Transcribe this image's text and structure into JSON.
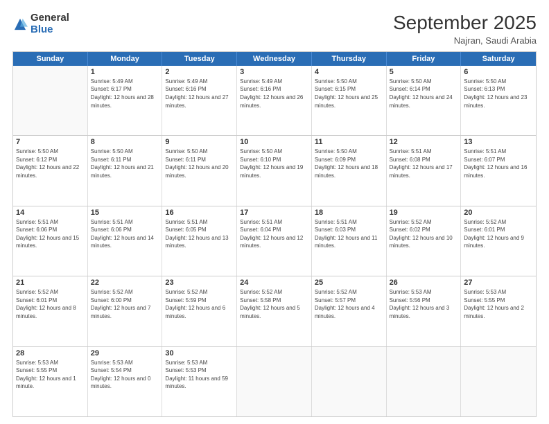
{
  "logo": {
    "general": "General",
    "blue": "Blue"
  },
  "header": {
    "month": "September 2025",
    "location": "Najran, Saudi Arabia"
  },
  "weekdays": [
    "Sunday",
    "Monday",
    "Tuesday",
    "Wednesday",
    "Thursday",
    "Friday",
    "Saturday"
  ],
  "weeks": [
    [
      {
        "day": "",
        "sunrise": "",
        "sunset": "",
        "daylight": ""
      },
      {
        "day": "1",
        "sunrise": "Sunrise: 5:49 AM",
        "sunset": "Sunset: 6:17 PM",
        "daylight": "Daylight: 12 hours and 28 minutes."
      },
      {
        "day": "2",
        "sunrise": "Sunrise: 5:49 AM",
        "sunset": "Sunset: 6:16 PM",
        "daylight": "Daylight: 12 hours and 27 minutes."
      },
      {
        "day": "3",
        "sunrise": "Sunrise: 5:49 AM",
        "sunset": "Sunset: 6:16 PM",
        "daylight": "Daylight: 12 hours and 26 minutes."
      },
      {
        "day": "4",
        "sunrise": "Sunrise: 5:50 AM",
        "sunset": "Sunset: 6:15 PM",
        "daylight": "Daylight: 12 hours and 25 minutes."
      },
      {
        "day": "5",
        "sunrise": "Sunrise: 5:50 AM",
        "sunset": "Sunset: 6:14 PM",
        "daylight": "Daylight: 12 hours and 24 minutes."
      },
      {
        "day": "6",
        "sunrise": "Sunrise: 5:50 AM",
        "sunset": "Sunset: 6:13 PM",
        "daylight": "Daylight: 12 hours and 23 minutes."
      }
    ],
    [
      {
        "day": "7",
        "sunrise": "Sunrise: 5:50 AM",
        "sunset": "Sunset: 6:12 PM",
        "daylight": "Daylight: 12 hours and 22 minutes."
      },
      {
        "day": "8",
        "sunrise": "Sunrise: 5:50 AM",
        "sunset": "Sunset: 6:11 PM",
        "daylight": "Daylight: 12 hours and 21 minutes."
      },
      {
        "day": "9",
        "sunrise": "Sunrise: 5:50 AM",
        "sunset": "Sunset: 6:11 PM",
        "daylight": "Daylight: 12 hours and 20 minutes."
      },
      {
        "day": "10",
        "sunrise": "Sunrise: 5:50 AM",
        "sunset": "Sunset: 6:10 PM",
        "daylight": "Daylight: 12 hours and 19 minutes."
      },
      {
        "day": "11",
        "sunrise": "Sunrise: 5:50 AM",
        "sunset": "Sunset: 6:09 PM",
        "daylight": "Daylight: 12 hours and 18 minutes."
      },
      {
        "day": "12",
        "sunrise": "Sunrise: 5:51 AM",
        "sunset": "Sunset: 6:08 PM",
        "daylight": "Daylight: 12 hours and 17 minutes."
      },
      {
        "day": "13",
        "sunrise": "Sunrise: 5:51 AM",
        "sunset": "Sunset: 6:07 PM",
        "daylight": "Daylight: 12 hours and 16 minutes."
      }
    ],
    [
      {
        "day": "14",
        "sunrise": "Sunrise: 5:51 AM",
        "sunset": "Sunset: 6:06 PM",
        "daylight": "Daylight: 12 hours and 15 minutes."
      },
      {
        "day": "15",
        "sunrise": "Sunrise: 5:51 AM",
        "sunset": "Sunset: 6:06 PM",
        "daylight": "Daylight: 12 hours and 14 minutes."
      },
      {
        "day": "16",
        "sunrise": "Sunrise: 5:51 AM",
        "sunset": "Sunset: 6:05 PM",
        "daylight": "Daylight: 12 hours and 13 minutes."
      },
      {
        "day": "17",
        "sunrise": "Sunrise: 5:51 AM",
        "sunset": "Sunset: 6:04 PM",
        "daylight": "Daylight: 12 hours and 12 minutes."
      },
      {
        "day": "18",
        "sunrise": "Sunrise: 5:51 AM",
        "sunset": "Sunset: 6:03 PM",
        "daylight": "Daylight: 12 hours and 11 minutes."
      },
      {
        "day": "19",
        "sunrise": "Sunrise: 5:52 AM",
        "sunset": "Sunset: 6:02 PM",
        "daylight": "Daylight: 12 hours and 10 minutes."
      },
      {
        "day": "20",
        "sunrise": "Sunrise: 5:52 AM",
        "sunset": "Sunset: 6:01 PM",
        "daylight": "Daylight: 12 hours and 9 minutes."
      }
    ],
    [
      {
        "day": "21",
        "sunrise": "Sunrise: 5:52 AM",
        "sunset": "Sunset: 6:01 PM",
        "daylight": "Daylight: 12 hours and 8 minutes."
      },
      {
        "day": "22",
        "sunrise": "Sunrise: 5:52 AM",
        "sunset": "Sunset: 6:00 PM",
        "daylight": "Daylight: 12 hours and 7 minutes."
      },
      {
        "day": "23",
        "sunrise": "Sunrise: 5:52 AM",
        "sunset": "Sunset: 5:59 PM",
        "daylight": "Daylight: 12 hours and 6 minutes."
      },
      {
        "day": "24",
        "sunrise": "Sunrise: 5:52 AM",
        "sunset": "Sunset: 5:58 PM",
        "daylight": "Daylight: 12 hours and 5 minutes."
      },
      {
        "day": "25",
        "sunrise": "Sunrise: 5:52 AM",
        "sunset": "Sunset: 5:57 PM",
        "daylight": "Daylight: 12 hours and 4 minutes."
      },
      {
        "day": "26",
        "sunrise": "Sunrise: 5:53 AM",
        "sunset": "Sunset: 5:56 PM",
        "daylight": "Daylight: 12 hours and 3 minutes."
      },
      {
        "day": "27",
        "sunrise": "Sunrise: 5:53 AM",
        "sunset": "Sunset: 5:55 PM",
        "daylight": "Daylight: 12 hours and 2 minutes."
      }
    ],
    [
      {
        "day": "28",
        "sunrise": "Sunrise: 5:53 AM",
        "sunset": "Sunset: 5:55 PM",
        "daylight": "Daylight: 12 hours and 1 minute."
      },
      {
        "day": "29",
        "sunrise": "Sunrise: 5:53 AM",
        "sunset": "Sunset: 5:54 PM",
        "daylight": "Daylight: 12 hours and 0 minutes."
      },
      {
        "day": "30",
        "sunrise": "Sunrise: 5:53 AM",
        "sunset": "Sunset: 5:53 PM",
        "daylight": "Daylight: 11 hours and 59 minutes."
      },
      {
        "day": "",
        "sunrise": "",
        "sunset": "",
        "daylight": ""
      },
      {
        "day": "",
        "sunrise": "",
        "sunset": "",
        "daylight": ""
      },
      {
        "day": "",
        "sunrise": "",
        "sunset": "",
        "daylight": ""
      },
      {
        "day": "",
        "sunrise": "",
        "sunset": "",
        "daylight": ""
      }
    ]
  ]
}
